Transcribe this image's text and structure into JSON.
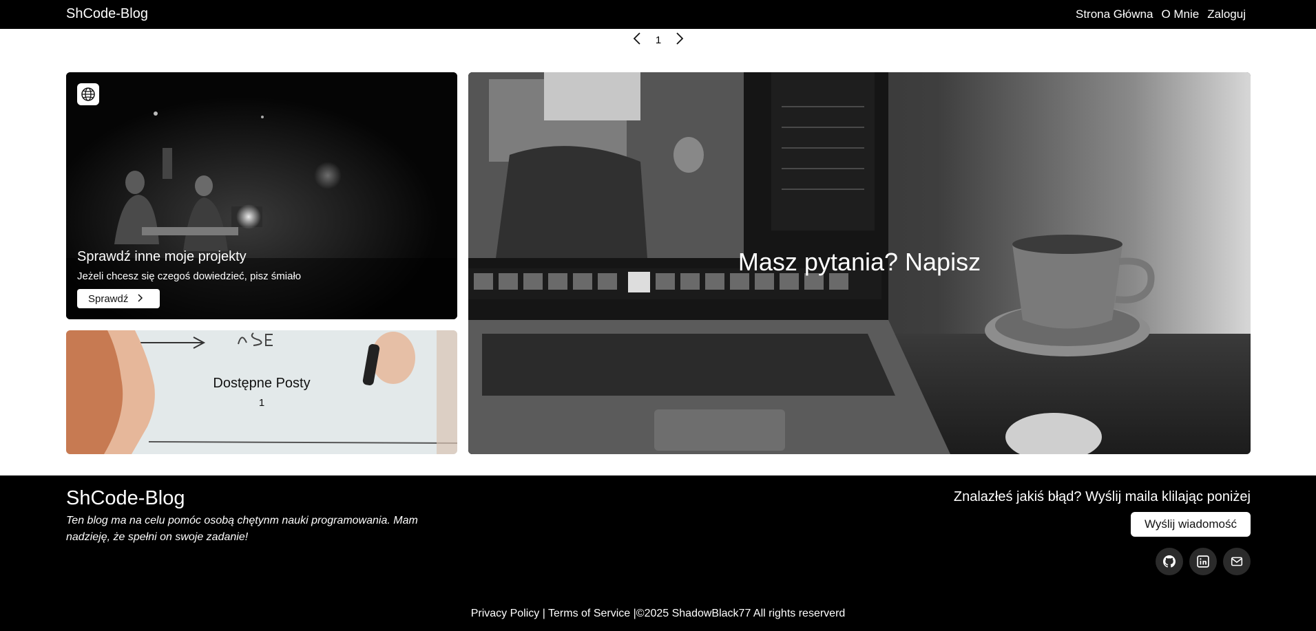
{
  "navbar": {
    "brand": "ShCode-Blog",
    "links": [
      "Strona Główna",
      "O Mnie",
      "Zaloguj"
    ]
  },
  "pager": {
    "page": "1",
    "prev_icon": "chevron-left-icon",
    "next_icon": "chevron-right-icon"
  },
  "projects_card": {
    "badge_icon": "globe-icon",
    "title": "Sprawdź inne moje projekty",
    "subtitle": "Jeżeli chcesz się czegoś dowiedzieć, pisz śmiało",
    "button_label": "Sprawdź",
    "button_icon": "chevron-right-icon"
  },
  "posts_card": {
    "title": "Dostępne Posty",
    "count": "1"
  },
  "contact_card": {
    "title": "Masz pytania? Napisz"
  },
  "footer": {
    "brand": "ShCode-Blog",
    "description": "Ten blog ma na celu pomóc osobą chętynm nauki programowania. Mam nadzieję, że spełni on swoje zadanie!",
    "bug_text": "Znalazłeś jakiś błąd? Wyślij maila klilając poniżej",
    "send_button": "Wyślij wiadomość",
    "social_icons": [
      "github-icon",
      "linkedin-icon",
      "mail-icon"
    ],
    "privacy": "Privacy Policy",
    "separator": "|",
    "terms": "Terms of Service",
    "copyright": "©2025 ShadowBlack77 All rights reserverd"
  },
  "colors": {
    "navbar_bg": "#000000",
    "footer_bg": "#000000",
    "page_bg": "#ffffff",
    "button_bg": "#ffffff"
  }
}
